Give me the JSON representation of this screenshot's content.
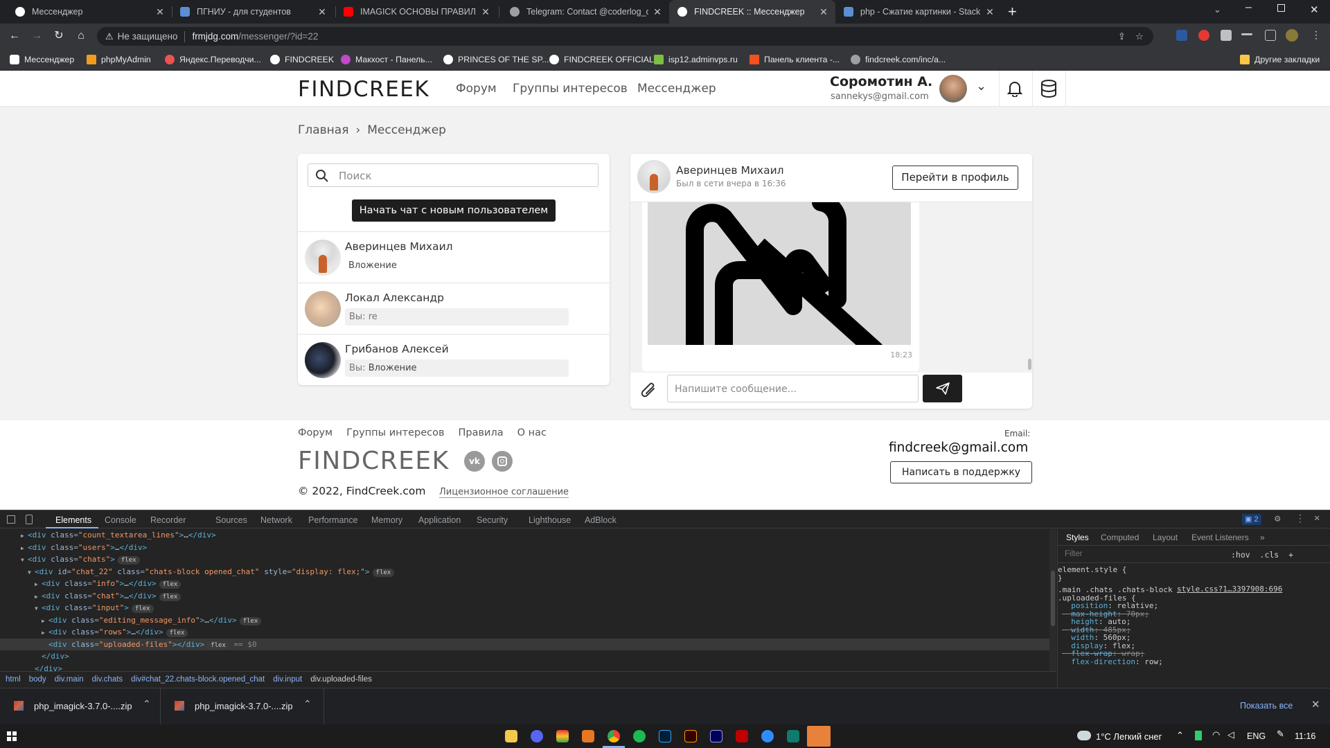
{
  "browser": {
    "tabs": [
      {
        "title": "Мессенджер",
        "color": "#ffffff"
      },
      {
        "title": "ПГНИУ - для студентов",
        "color": "#5a8fd6"
      },
      {
        "title": "IMAGICK ОСНОВЫ ПРАВИЛЬНОГ",
        "color": "#ff0000"
      },
      {
        "title": "Telegram: Contact @coderlog_ch",
        "color": "#9aa0a6"
      },
      {
        "title": "FINDCREEK :: Мессенджер",
        "color": "#ffffff"
      },
      {
        "title": "php - Сжатие картинки - Stack O",
        "color": "#5a8fd6"
      }
    ],
    "active_tab_index": 4,
    "new_tab": "+",
    "url_security": "Не защищено",
    "url_host": "frmjdg.com",
    "url_path": "/messenger/?id=22",
    "bookmarks": [
      "Мессенджер",
      "phpMyAdmin",
      "Яндекс.Переводчи...",
      "FINDCREEK",
      "Макхост - Панель...",
      "PRINCES OF THE SP...",
      "FINDCREEK OFFICIAL",
      "isp12.adminvps.ru",
      "Панель клиента -...",
      "findcreek.com/inc/a..."
    ],
    "other_bookmarks": "Другие закладки"
  },
  "site": {
    "logo": "FINDCREEK",
    "nav": [
      "Форум",
      "Группы интересов",
      "Мессенджер"
    ],
    "user_name": "Соромотин А.",
    "user_email": "sannekys@gmail.com",
    "breadcrumb_home": "Главная",
    "breadcrumb_sep": "›",
    "breadcrumb_current": "Мессенджер",
    "search_placeholder": "Поиск",
    "new_chat_button": "Начать чат с новым пользователем",
    "chats": [
      {
        "name": "Аверинцев Михаил",
        "preview_prefix": "",
        "preview": "Вложение"
      },
      {
        "name": "Локал Александр",
        "preview_prefix": "Вы:",
        "preview": "re"
      },
      {
        "name": "Грибанов Алексей",
        "preview_prefix": "Вы:",
        "preview": "Вложение"
      }
    ],
    "chat_header_name": "Аверинцев Михаил",
    "chat_header_status": "Был в сети вчера в 16:36",
    "profile_button": "Перейти в профиль",
    "message_time": "18:23",
    "message_placeholder": "Напишите сообщение...",
    "footer_links": [
      "Форум",
      "Группы интересов",
      "Правила",
      "О нас"
    ],
    "footer_logo": "FINDCREEK",
    "copyright": "© 2022, FindCreek.com",
    "license": "Лицензионное соглашение",
    "email_label": "Email:",
    "email": "findcreek@gmail.com",
    "support_button": "Написать в поддержку",
    "colors": {
      "accent": "#1e1e1e",
      "page_bg": "#f2f2f2"
    }
  },
  "devtools": {
    "tabs": [
      "Elements",
      "Console",
      "Recorder",
      "Sources",
      "Network",
      "Performance",
      "Memory",
      "Application",
      "Security",
      "Lighthouse",
      "AdBlock"
    ],
    "issues_count": "2",
    "dom_lines": [
      {
        "indent": 3,
        "arrow": "▶",
        "tag": "div",
        "cls": "count_textarea_lines",
        "tail": ">…</div>",
        "pill": ""
      },
      {
        "indent": 3,
        "arrow": "▶",
        "tag": "div",
        "cls": "users",
        "tail": ">…</div>",
        "pill": ""
      },
      {
        "indent": 3,
        "arrow": "▼",
        "tag": "div",
        "cls": "chats",
        "tail": ">",
        "pill": "flex"
      },
      {
        "indent": 4,
        "arrow": "▼",
        "tag": "div",
        "cls": "chats-block opened_chat",
        "id": "chat_22",
        "style": "display: flex;",
        "tail": ">",
        "pill": "flex"
      },
      {
        "indent": 5,
        "arrow": "▶",
        "tag": "div",
        "cls": "info",
        "tail": ">…</div>",
        "pill": "flex"
      },
      {
        "indent": 5,
        "arrow": "▶",
        "tag": "div",
        "cls": "chat",
        "tail": ">…</div>",
        "pill": "flex"
      },
      {
        "indent": 5,
        "arrow": "▼",
        "tag": "div",
        "cls": "input",
        "tail": ">",
        "pill": "flex"
      },
      {
        "indent": 6,
        "arrow": "▶",
        "tag": "div",
        "cls": "editing_message_info",
        "tail": ">…</div>",
        "pill": "flex"
      },
      {
        "indent": 6,
        "arrow": "▶",
        "tag": "div",
        "cls": "rows",
        "tail": ">…</div>",
        "pill": "flex"
      },
      {
        "indent": 6,
        "arrow": "",
        "tag": "div",
        "cls": "uploaded-files",
        "tail": "></div>",
        "pill": "flex",
        "selected": true,
        "suffix": "== $0"
      },
      {
        "indent": 5,
        "arrow": "",
        "close": "</div>"
      },
      {
        "indent": 4,
        "arrow": "",
        "close": "</div>"
      }
    ],
    "breadcrumbs": [
      "html",
      "body",
      "div.main",
      "div.chats",
      "div#chat_22.chats-block.opened_chat",
      "div.input",
      "div.uploaded-files"
    ],
    "styles_tabs": [
      "Styles",
      "Computed",
      "Layout",
      "Event Listeners",
      "»"
    ],
    "filter_placeholder": "Filter",
    "filter_tools": ":hov  .cls  +",
    "style_lines": [
      "element.style {",
      "}",
      ".main .chats .chats-block",
      ".uploaded-files {",
      "  position: relative;",
      "  max-height: 70px;",
      "  height: auto;",
      "  width: 485px;",
      "  width: 560px;",
      "  display: flex;",
      "  flex-wrap: wrap;",
      "  flex-direction: row;"
    ],
    "style_source": "style.css?1…3397908:696"
  },
  "downloads": {
    "items": [
      "php_imagick-3.7.0-....zip",
      "php_imagick-3.7.0-....zip"
    ],
    "show_all": "Показать все"
  },
  "taskbar": {
    "weather": "1°C  Легкий снег",
    "lang": "ENG",
    "time": "11:16"
  }
}
